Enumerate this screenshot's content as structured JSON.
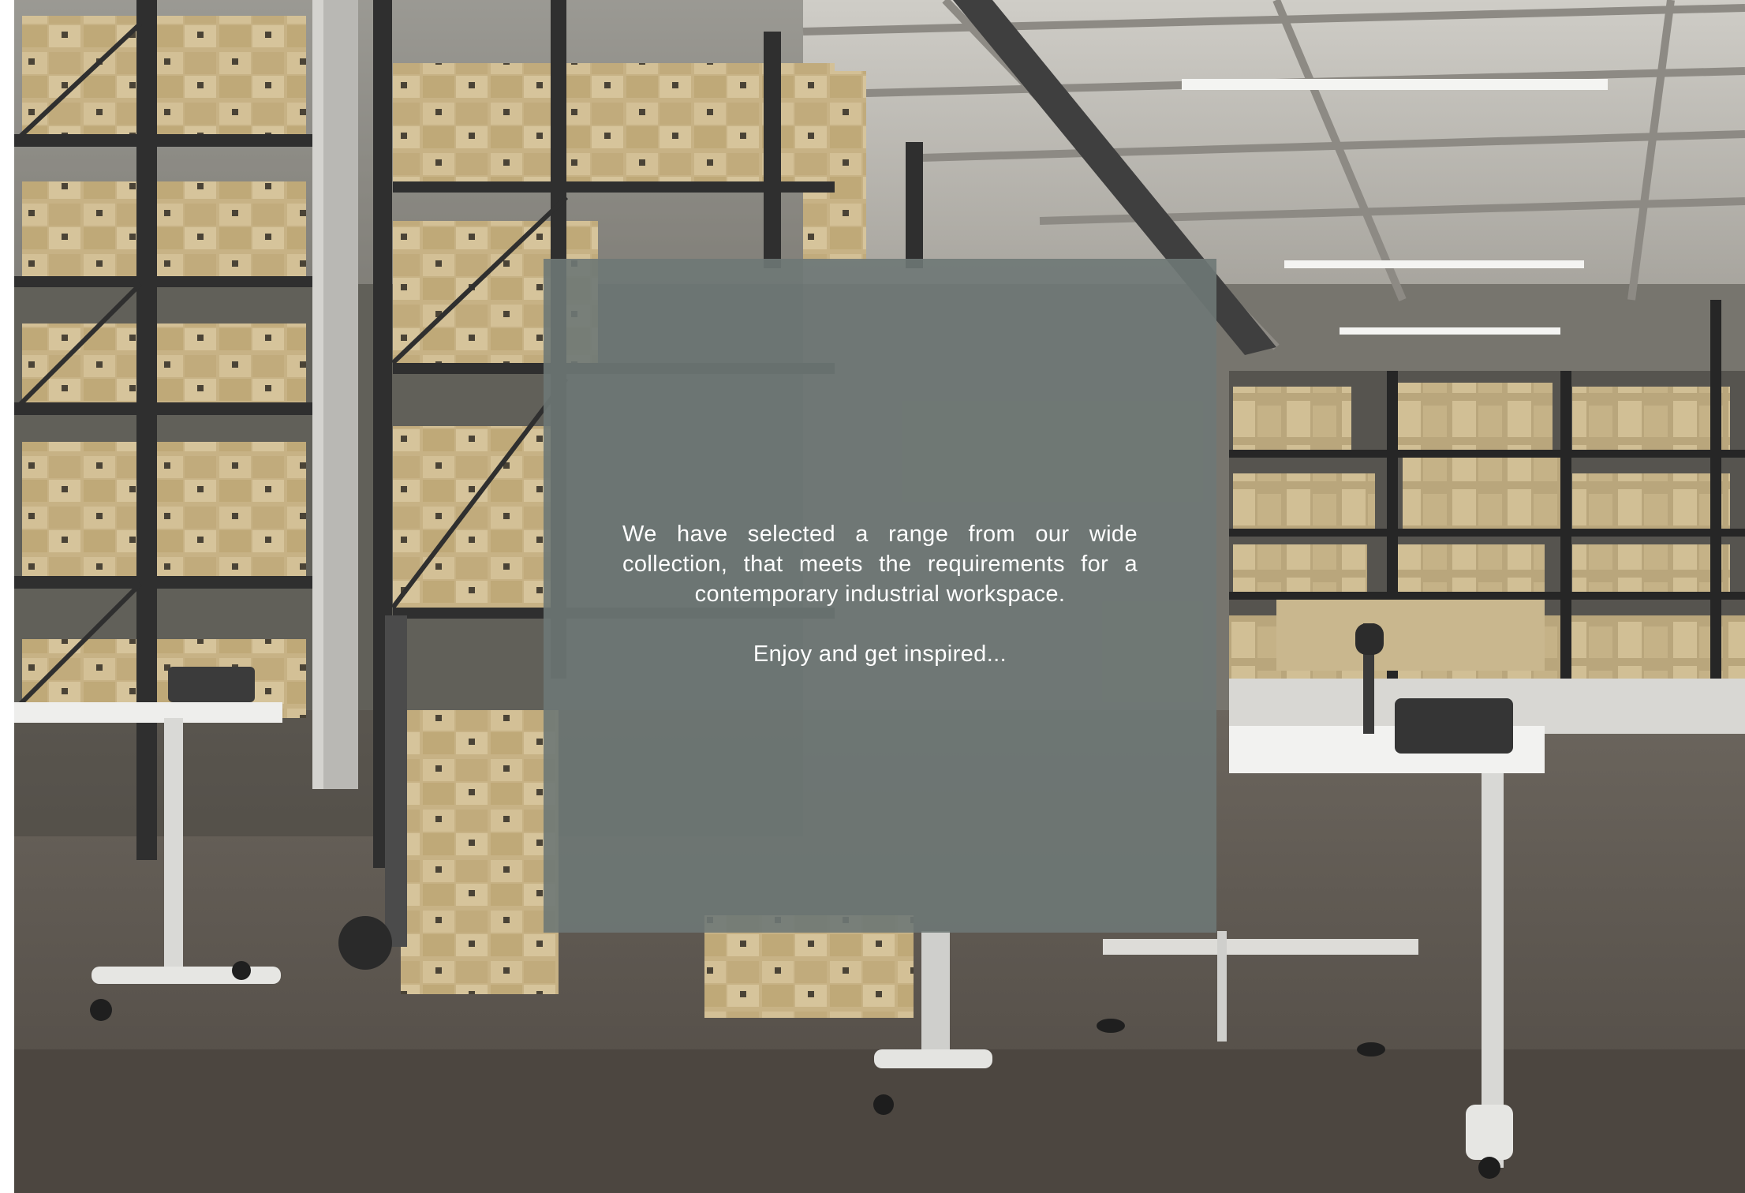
{
  "scene": {
    "icon": "warehouse-photo",
    "colors": {
      "ceiling": "#bfbcb5",
      "wall": "#77756e",
      "floor": "#5e574f",
      "rack_frame": "#3a3a3a",
      "box": "#cdb88c",
      "desk": "#eeeeec"
    }
  },
  "overlay": {
    "background": "#6e7875",
    "body_text": "We have selected a range from our wide collection, that meets the requirements for a contemporary industrial workspace.",
    "cta_text": "Enjoy and get inspired..."
  }
}
